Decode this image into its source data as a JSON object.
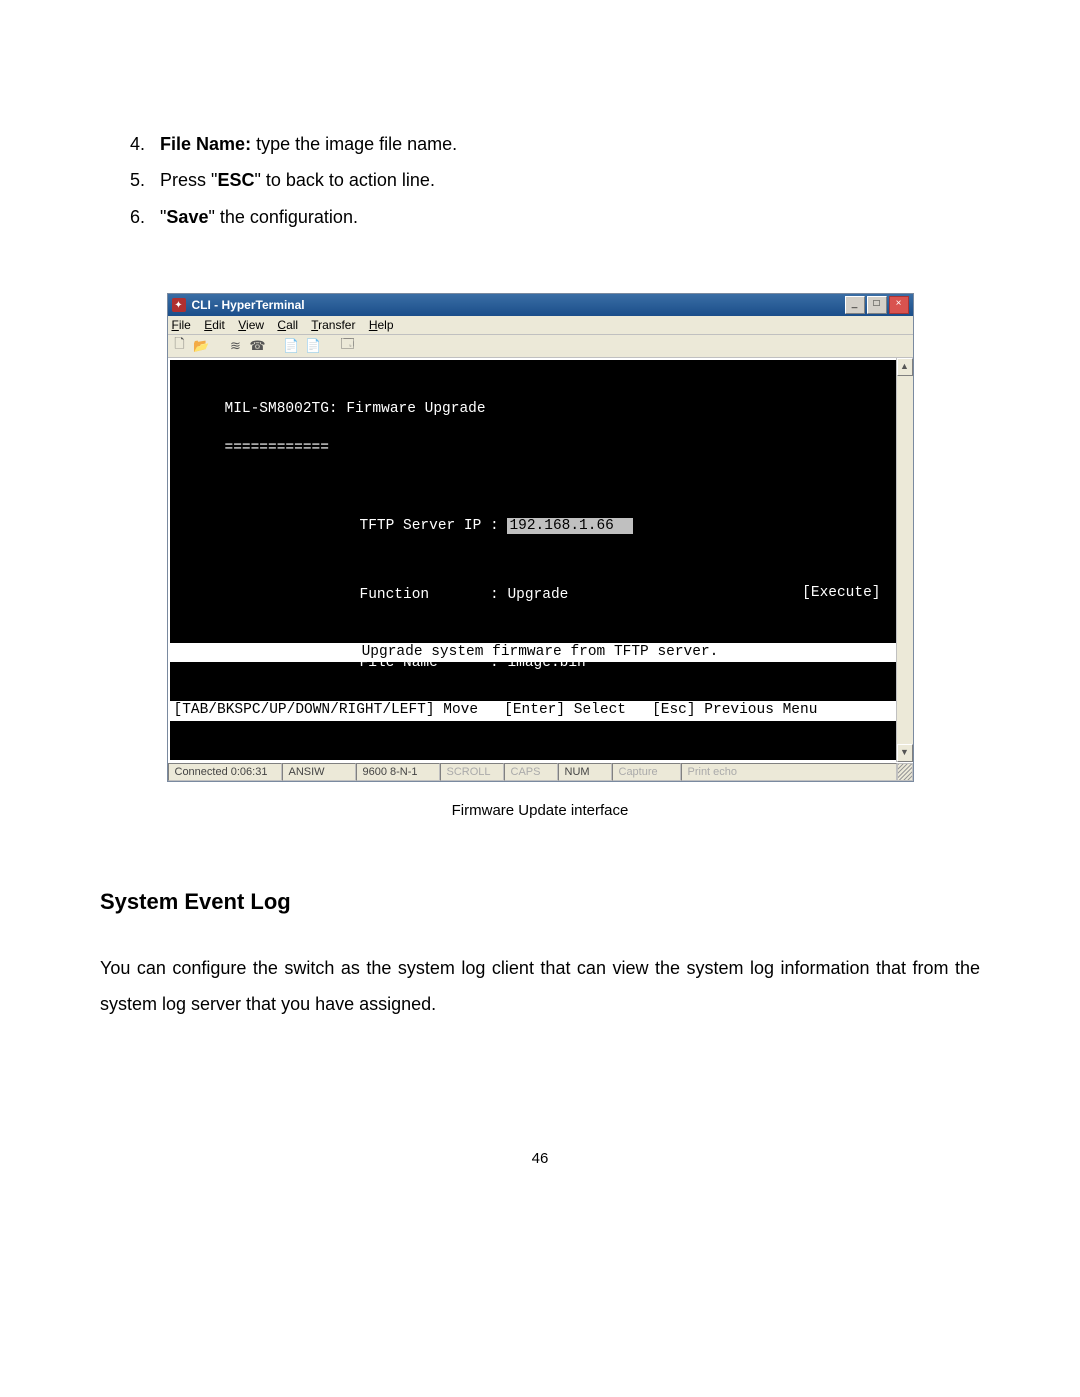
{
  "instructions": {
    "item4": {
      "num": "4.",
      "bold": "File Name:",
      "rest": " type the image file name."
    },
    "item5": {
      "num": "5.",
      "pre": "Press \"",
      "bold": "ESC",
      "post": "\" to back to action line."
    },
    "item6": {
      "num": "6.",
      "pre": "\"",
      "bold": "Save",
      "post": "\" the configuration."
    }
  },
  "window": {
    "title": "CLI - HyperTerminal",
    "menu": {
      "file": "File",
      "edit": "Edit",
      "view": "View",
      "call": "Call",
      "transfer": "Transfer",
      "help": "Help"
    },
    "toolbar_icons": {
      "new": "🗋",
      "open": "📂",
      "save": "≋",
      "disconnect": "☎",
      "send": "📄",
      "receive": "📄",
      "properties": "🗔"
    },
    "win_buttons": {
      "min": "_",
      "max": "□",
      "close": "×"
    }
  },
  "terminal": {
    "header": "MIL-SM8002TG: Firmware Upgrade",
    "divider": "============",
    "f_ip_label": "TFTP Server IP : ",
    "f_ip_value": "192.168.1.66  ",
    "f_func_label": "Function       : ",
    "f_func_value": "Upgrade",
    "f_file_label": "File Name      : ",
    "f_file_value": "image.bin",
    "execute": "[Execute]",
    "hint": "Upgrade system firmware from TFTP server.",
    "nav": "[TAB/BKSPC/UP/DOWN/RIGHT/LEFT] Move   [Enter] Select   [Esc] Previous Menu"
  },
  "status": {
    "connected": "Connected 0:06:31",
    "emul": "ANSIW",
    "params": "9600 8-N-1",
    "scroll": "SCROLL",
    "caps": "CAPS",
    "num": "NUM",
    "capture": "Capture",
    "echo": "Print echo"
  },
  "caption": "Firmware Update interface",
  "section_heading": "System Event Log",
  "body_para": "You can configure the switch as the system log client that can view the system log information that from the system log server that you have assigned.",
  "page_number": "46"
}
